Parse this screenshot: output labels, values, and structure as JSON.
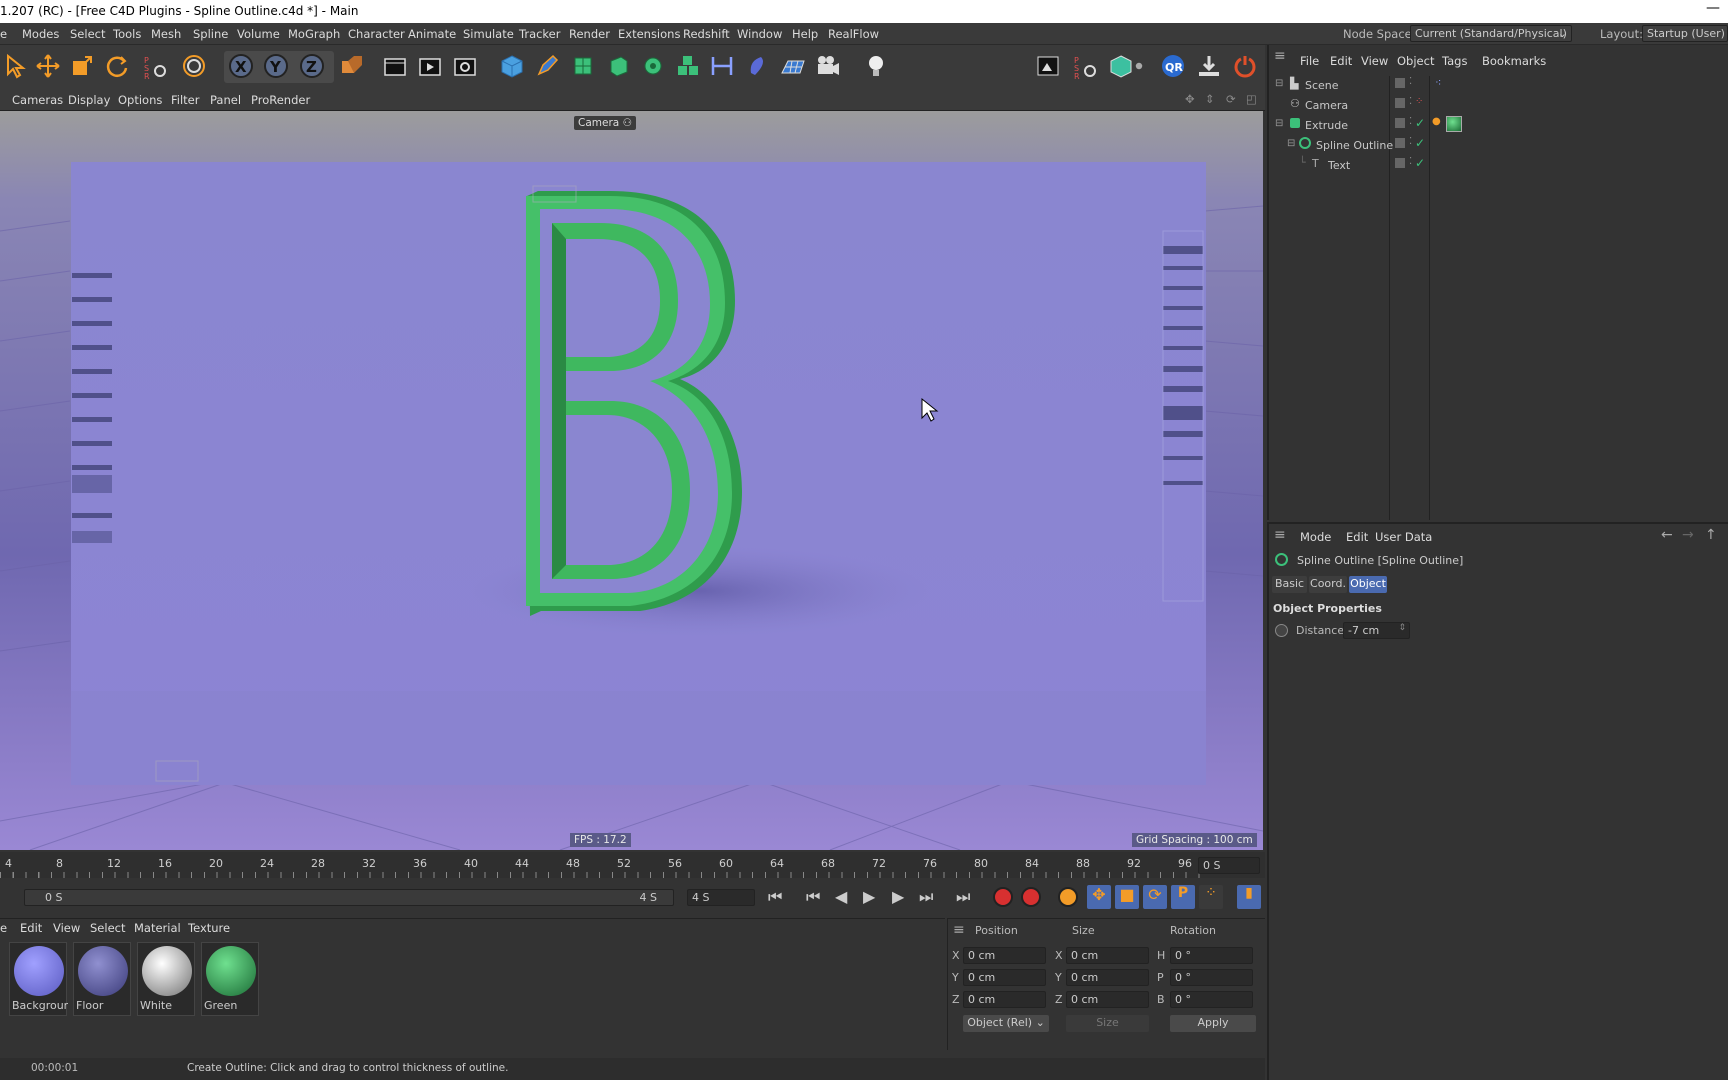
{
  "window": {
    "title": "1.207 (RC) - [Free C4D Plugins - Spline Outline.c4d *] - Main",
    "minimize": "—"
  },
  "menubar": {
    "items": [
      "e",
      "Modes",
      "Select",
      "Tools",
      "Mesh",
      "Spline",
      "Volume",
      "MoGraph",
      "Character",
      "Animate",
      "Simulate",
      "Tracker",
      "Render",
      "Extensions",
      "Redshift",
      "Window",
      "Help",
      "RealFlow"
    ],
    "node_space_label": "Node Space:",
    "node_space_value": "Current (Standard/Physical)",
    "layout_label": "Layout:",
    "layout_value": "Startup (User)"
  },
  "viewport_menu": {
    "items": [
      "Cameras",
      "Display",
      "Options",
      "Filter",
      "Panel",
      "ProRender"
    ]
  },
  "viewport": {
    "camera_label": "Camera",
    "fps": "FPS : 17.2",
    "grid_spacing": "Grid Spacing : 100 cm",
    "letter": "B",
    "colors": {
      "background": "#8a84cc",
      "letter": "#3fb85f",
      "floor": "#7f78c2"
    }
  },
  "timeline": {
    "ticks": [
      "4",
      "8",
      "12",
      "16",
      "20",
      "24",
      "28",
      "32",
      "36",
      "40",
      "44",
      "48",
      "52",
      "56",
      "60",
      "64",
      "68",
      "72",
      "76",
      "80",
      "84",
      "88",
      "92",
      "96"
    ],
    "current_frame": "0 S",
    "start": "0 S",
    "end_label": "4 S",
    "end_field": "4 S"
  },
  "materials": {
    "menu": [
      "e",
      "Edit",
      "View",
      "Select",
      "Material",
      "Texture"
    ],
    "items": [
      {
        "name": "Background",
        "color": "#7f7fd8"
      },
      {
        "name": "Floor",
        "color": "#6a6aa8"
      },
      {
        "name": "White",
        "color": "#d8d8d8"
      },
      {
        "name": "Green",
        "color": "#2da64b"
      }
    ]
  },
  "coordinates": {
    "headers": [
      "Position",
      "Size",
      "Rotation"
    ],
    "rows": [
      {
        "axis": "X",
        "pos": "0 cm",
        "saxis": "X",
        "size": "0 cm",
        "raxis": "H",
        "rot": "0 °"
      },
      {
        "axis": "Y",
        "pos": "0 cm",
        "saxis": "Y",
        "size": "0 cm",
        "raxis": "P",
        "rot": "0 °"
      },
      {
        "axis": "Z",
        "pos": "0 cm",
        "saxis": "Z",
        "size": "0 cm",
        "raxis": "B",
        "rot": "0 °"
      }
    ],
    "mode": "Object (Rel)",
    "size_mode": "Size",
    "apply": "Apply"
  },
  "status": {
    "time": "00:00:01",
    "message": "Create Outline: Click and drag to control thickness of outline."
  },
  "object_manager": {
    "menu": [
      "File",
      "Edit",
      "View",
      "Object",
      "Tags",
      "Bookmarks"
    ],
    "objects": [
      {
        "name": "Scene",
        "color": "#c8c8c8"
      },
      {
        "name": "Camera",
        "color": "#c8c8c8"
      },
      {
        "name": "Extrude",
        "color": "#e08a3a"
      },
      {
        "name": "Spline Outline",
        "color": "#f0c040"
      },
      {
        "name": "Text",
        "color": "#e08a3a"
      }
    ]
  },
  "attribute_manager": {
    "menu": [
      "Mode",
      "Edit",
      "User Data"
    ],
    "object_title": "Spline Outline [Spline Outline]",
    "tabs": [
      "Basic",
      "Coord.",
      "Object"
    ],
    "active_tab": "Object",
    "section": "Object Properties",
    "distance_label": "Distance",
    "distance_value": "-7 cm"
  }
}
